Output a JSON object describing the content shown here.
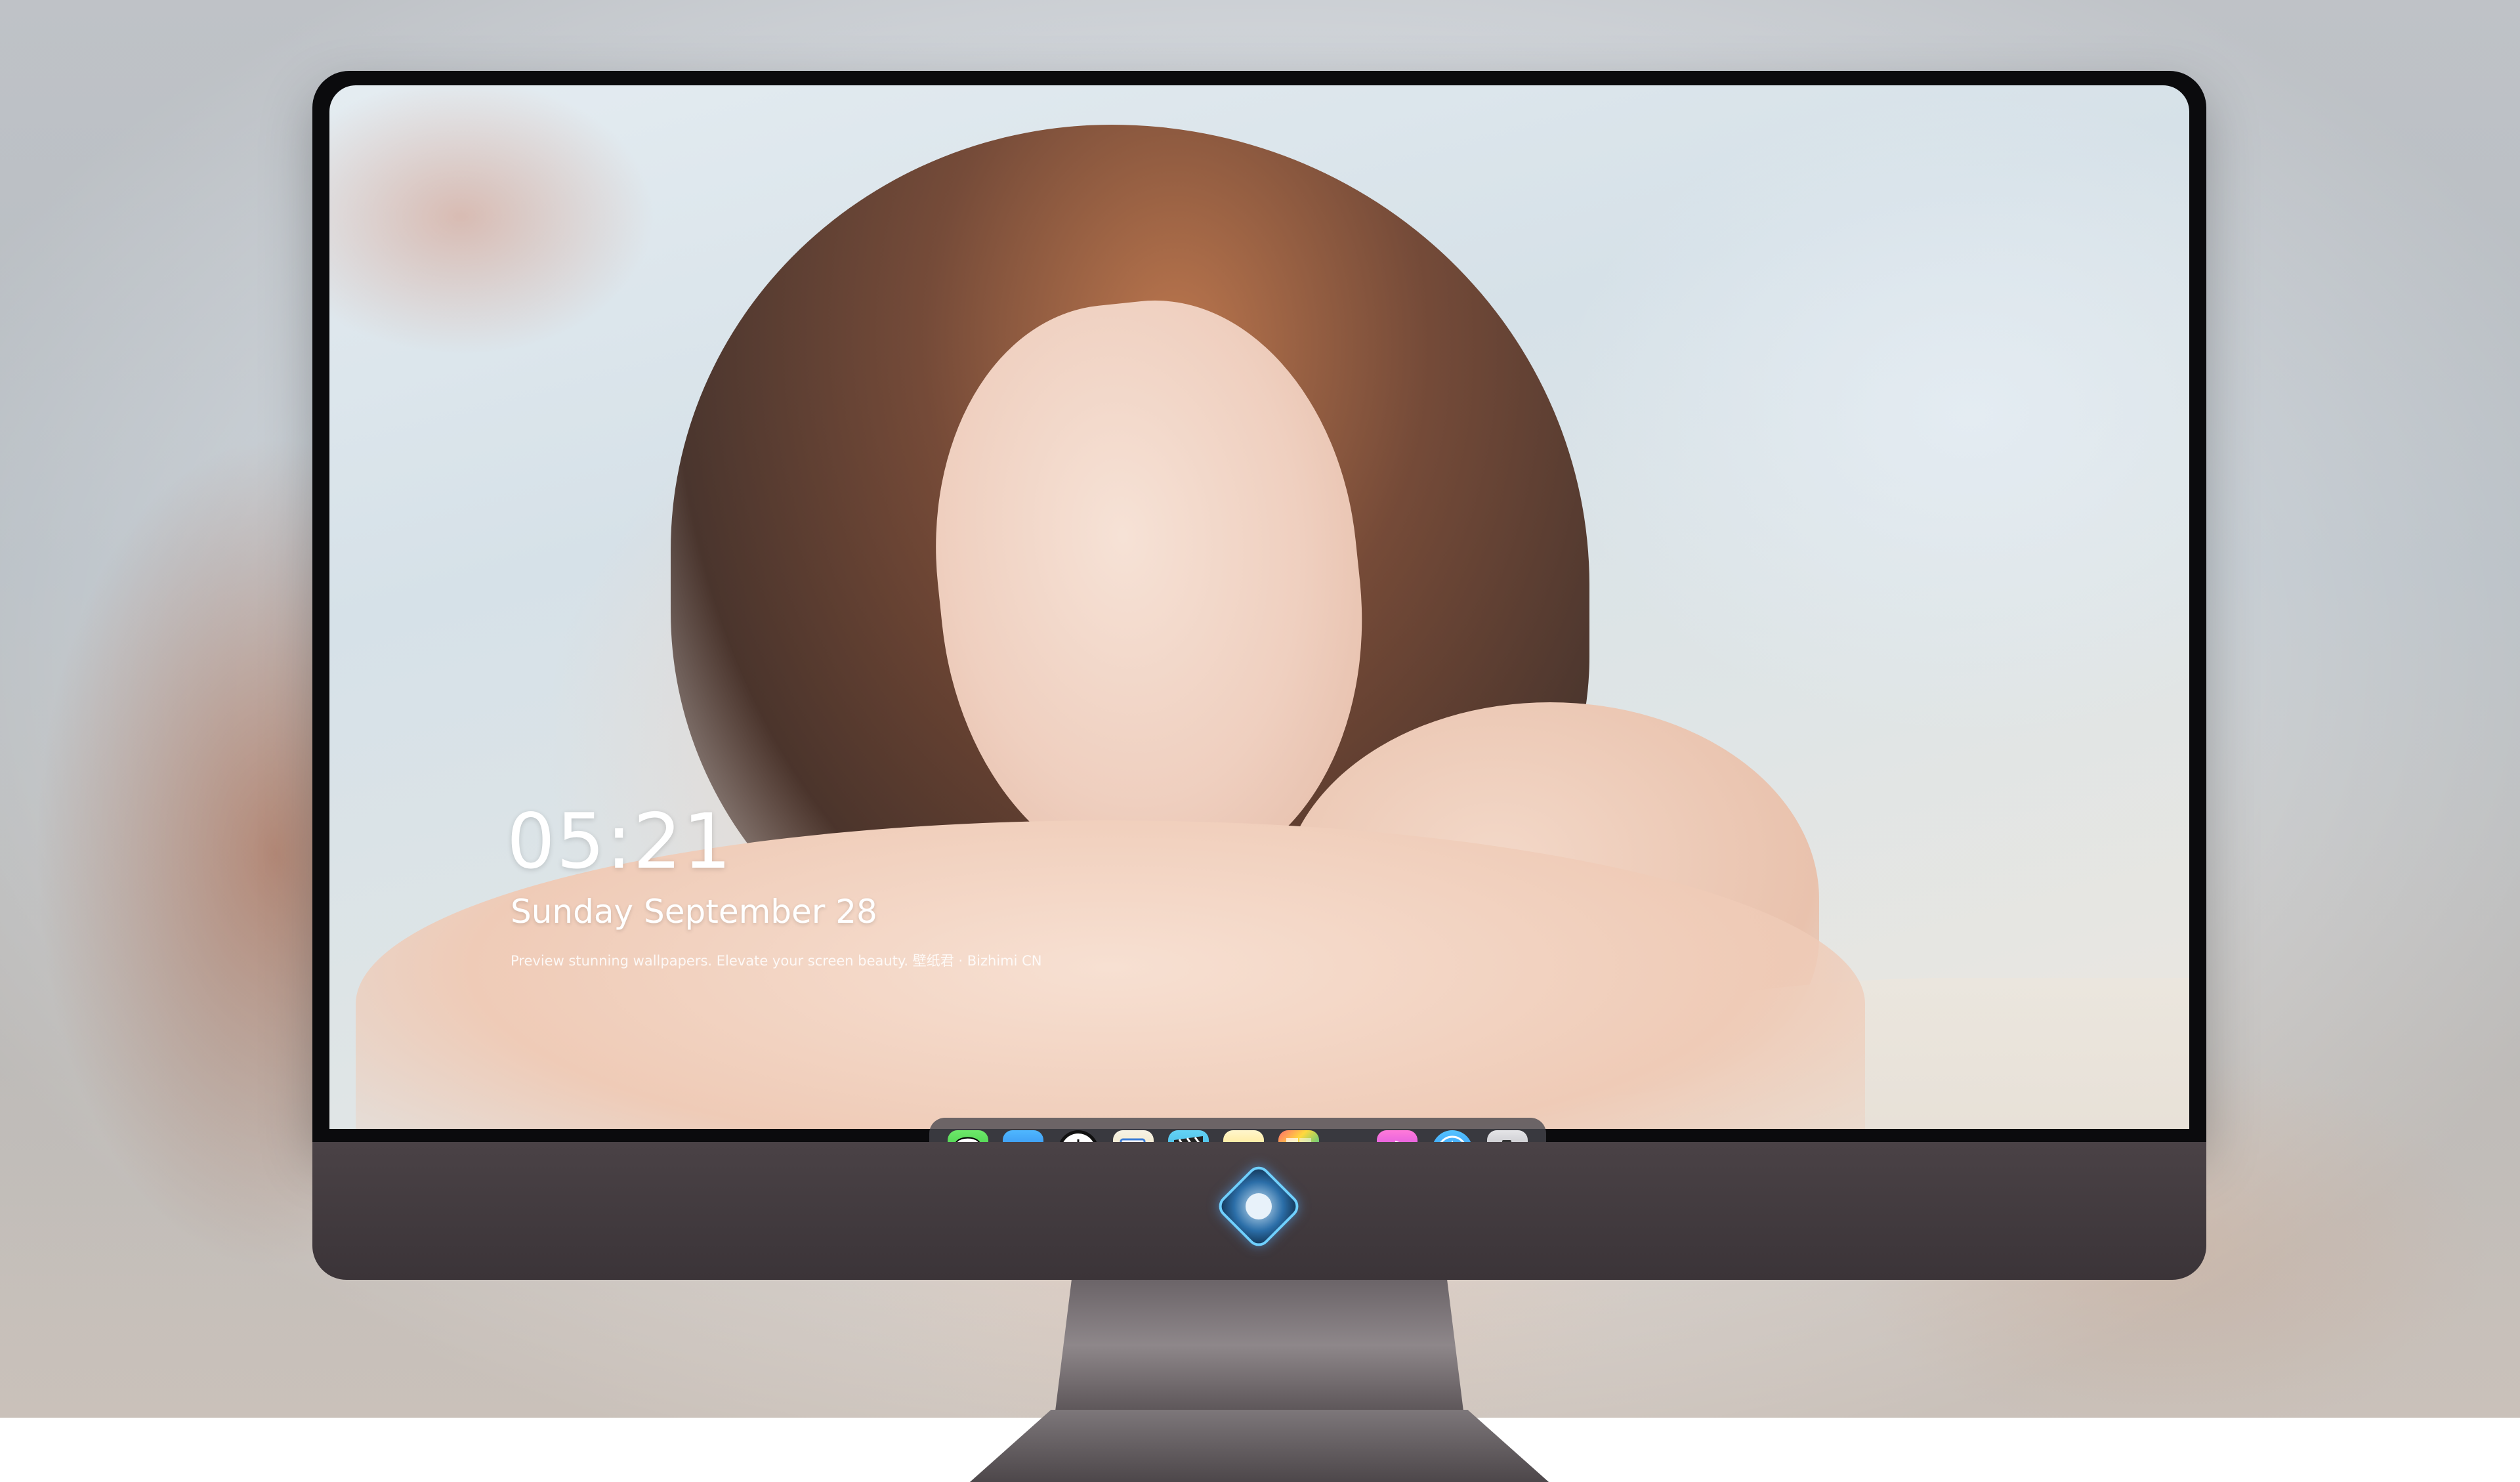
{
  "lockscreen": {
    "time": "05:21",
    "date": "Sunday September  28",
    "caption": "Preview stunning wallpapers. Elevate your screen beauty. 壁纸君 · Bizhimi CN"
  },
  "dock": {
    "apps": [
      {
        "name": "Messages",
        "icon": "messages-icon"
      },
      {
        "name": "Weather",
        "icon": "weather-icon"
      },
      {
        "name": "Clock",
        "icon": "clock-icon"
      },
      {
        "name": "Preview",
        "icon": "preview-icon"
      },
      {
        "name": "Clips",
        "icon": "clips-icon"
      },
      {
        "name": "Notes",
        "icon": "notes-icon"
      },
      {
        "name": "Photo Booth",
        "icon": "photo-booth-icon"
      },
      {
        "name": "iTunes",
        "icon": "music-icon"
      },
      {
        "name": "App Store",
        "icon": "app-store-icon"
      },
      {
        "name": "Camera",
        "icon": "camera-icon"
      }
    ]
  },
  "colors": {
    "bezel": "#0b0b0d",
    "chin": "#433b3f",
    "dock": "#46464e",
    "clock_text": "#ffffff"
  }
}
